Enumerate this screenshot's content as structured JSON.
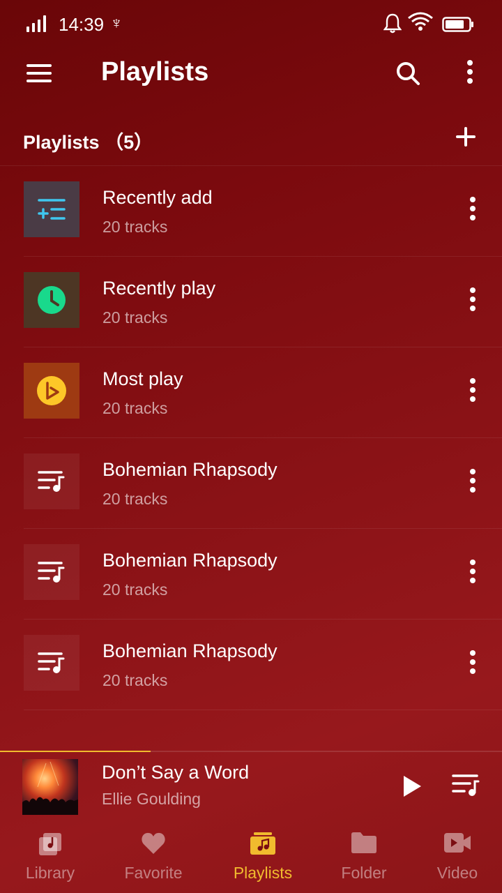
{
  "status_bar": {
    "time": "14:39",
    "usb_glyph": "♆",
    "icons": [
      "signal-icon",
      "usb-icon",
      "bell-icon",
      "wifi-icon",
      "battery-icon"
    ]
  },
  "app_bar": {
    "title": "Playlists",
    "icons": [
      "menu-icon",
      "search-icon",
      "more-vert-icon"
    ]
  },
  "section": {
    "title": "Playlists （5）",
    "add_icon": "plus-icon"
  },
  "playlists": [
    {
      "title": "Recently add",
      "subtitle": "20 tracks",
      "icon": "playlist-add-icon",
      "thumb_color": "#4a3b45",
      "icon_color": "#3fc7ef"
    },
    {
      "title": "Recently play",
      "subtitle": "20 tracks",
      "icon": "clock-icon",
      "thumb_color": "#4d3624",
      "icon_color": "#19d98c"
    },
    {
      "title": "Most play",
      "subtitle": "20 tracks",
      "icon": "play-circle-icon",
      "thumb_color": "#9e3a12",
      "icon_color": "#fdc728"
    },
    {
      "title": "Bohemian Rhapsody",
      "subtitle": "20 tracks",
      "icon": "music-list-icon",
      "thumb_color": "#8a1a1c",
      "icon_color": "#ffffff"
    },
    {
      "title": "Bohemian Rhapsody",
      "subtitle": "20 tracks",
      "icon": "music-list-icon",
      "thumb_color": "#8a1a1c",
      "icon_color": "#ffffff"
    },
    {
      "title": "Bohemian Rhapsody",
      "subtitle": "20 tracks",
      "icon": "music-list-icon",
      "thumb_color": "#8a1a1c",
      "icon_color": "#ffffff"
    }
  ],
  "now_playing": {
    "title": "Don’t Say a Word",
    "artist": "Ellie Goulding",
    "progress": 0.3,
    "icons": [
      "play-icon",
      "queue-icon"
    ]
  },
  "bottom_nav": {
    "items": [
      {
        "label": "Library",
        "icon": "library-icon",
        "active": false
      },
      {
        "label": "Favorite",
        "icon": "heart-icon",
        "active": false
      },
      {
        "label": "Playlists",
        "icon": "playlist-folder-icon",
        "active": true
      },
      {
        "label": "Folder",
        "icon": "folder-icon",
        "active": false
      },
      {
        "label": "Video",
        "icon": "video-icon",
        "active": false
      }
    ]
  },
  "colors": {
    "accent": "#f1bb2e",
    "background": "#8a1216",
    "text_secondary": "rgba(255,255,255,0.6)"
  }
}
